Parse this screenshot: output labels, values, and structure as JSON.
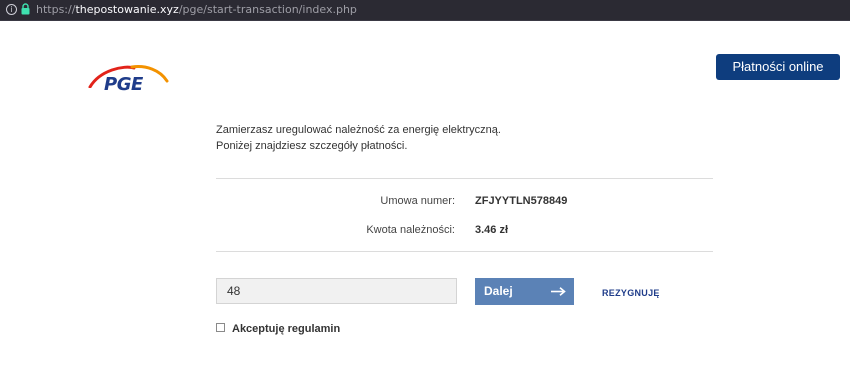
{
  "browser": {
    "url_prefix": "https://",
    "url_host": "thepostowanie.xyz",
    "url_path": "/pge/start-transaction/index.php"
  },
  "header": {
    "logo_text": "PGE",
    "online_button": "Płatności online"
  },
  "intro": {
    "line1": "Zamierzasz uregulować należność za energię elektryczną.",
    "line2": "Poniżej znajdziesz szczegóły płatności."
  },
  "details": {
    "contract_label": "Umowa numer:",
    "contract_value": "ZFJYYTLN578849",
    "amount_label": "Kwota należności:",
    "amount_value": "3.46 zł"
  },
  "form": {
    "input_value": "48",
    "next_button": "Dalej",
    "cancel_link": "REZYGNUJĘ",
    "terms_label": "Akceptuję regulamin",
    "terms_checked": false
  },
  "colors": {
    "brand_blue": "#0e3d7e",
    "button_blue": "#5b82b6",
    "logo_red": "#e2231a",
    "logo_orange": "#f39200"
  }
}
